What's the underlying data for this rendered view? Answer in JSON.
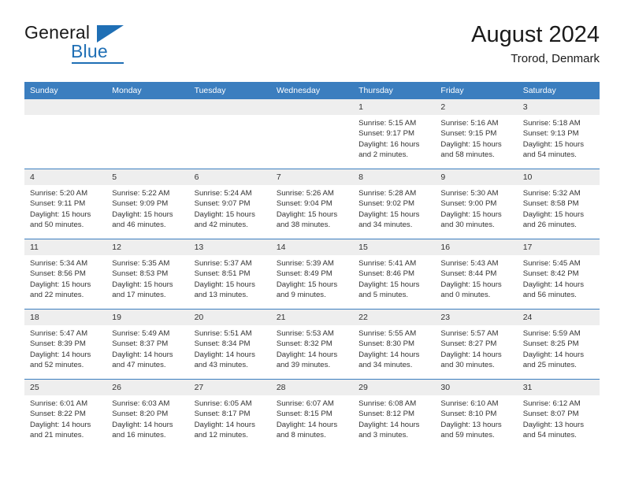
{
  "brand": {
    "name_part1": "General",
    "name_part2": "Blue",
    "flag_icon": "triangle-flag-icon"
  },
  "header": {
    "title": "August 2024",
    "subtitle": "Trorod, Denmark"
  },
  "colors": {
    "header_blue": "#3b7ebf",
    "brand_blue": "#1f6fb5",
    "daynum_band": "#eeeeee",
    "text": "#333333"
  },
  "weekdays": [
    "Sunday",
    "Monday",
    "Tuesday",
    "Wednesday",
    "Thursday",
    "Friday",
    "Saturday"
  ],
  "weeks": [
    [
      {
        "day": "",
        "empty": true,
        "sunrise": "",
        "sunset": "",
        "daylight_line1": "",
        "daylight_line2": ""
      },
      {
        "day": "",
        "empty": true,
        "sunrise": "",
        "sunset": "",
        "daylight_line1": "",
        "daylight_line2": ""
      },
      {
        "day": "",
        "empty": true,
        "sunrise": "",
        "sunset": "",
        "daylight_line1": "",
        "daylight_line2": ""
      },
      {
        "day": "",
        "empty": true,
        "sunrise": "",
        "sunset": "",
        "daylight_line1": "",
        "daylight_line2": ""
      },
      {
        "day": "1",
        "sunrise": "Sunrise: 5:15 AM",
        "sunset": "Sunset: 9:17 PM",
        "daylight_line1": "Daylight: 16 hours",
        "daylight_line2": "and 2 minutes."
      },
      {
        "day": "2",
        "sunrise": "Sunrise: 5:16 AM",
        "sunset": "Sunset: 9:15 PM",
        "daylight_line1": "Daylight: 15 hours",
        "daylight_line2": "and 58 minutes."
      },
      {
        "day": "3",
        "sunrise": "Sunrise: 5:18 AM",
        "sunset": "Sunset: 9:13 PM",
        "daylight_line1": "Daylight: 15 hours",
        "daylight_line2": "and 54 minutes."
      }
    ],
    [
      {
        "day": "4",
        "sunrise": "Sunrise: 5:20 AM",
        "sunset": "Sunset: 9:11 PM",
        "daylight_line1": "Daylight: 15 hours",
        "daylight_line2": "and 50 minutes."
      },
      {
        "day": "5",
        "sunrise": "Sunrise: 5:22 AM",
        "sunset": "Sunset: 9:09 PM",
        "daylight_line1": "Daylight: 15 hours",
        "daylight_line2": "and 46 minutes."
      },
      {
        "day": "6",
        "sunrise": "Sunrise: 5:24 AM",
        "sunset": "Sunset: 9:07 PM",
        "daylight_line1": "Daylight: 15 hours",
        "daylight_line2": "and 42 minutes."
      },
      {
        "day": "7",
        "sunrise": "Sunrise: 5:26 AM",
        "sunset": "Sunset: 9:04 PM",
        "daylight_line1": "Daylight: 15 hours",
        "daylight_line2": "and 38 minutes."
      },
      {
        "day": "8",
        "sunrise": "Sunrise: 5:28 AM",
        "sunset": "Sunset: 9:02 PM",
        "daylight_line1": "Daylight: 15 hours",
        "daylight_line2": "and 34 minutes."
      },
      {
        "day": "9",
        "sunrise": "Sunrise: 5:30 AM",
        "sunset": "Sunset: 9:00 PM",
        "daylight_line1": "Daylight: 15 hours",
        "daylight_line2": "and 30 minutes."
      },
      {
        "day": "10",
        "sunrise": "Sunrise: 5:32 AM",
        "sunset": "Sunset: 8:58 PM",
        "daylight_line1": "Daylight: 15 hours",
        "daylight_line2": "and 26 minutes."
      }
    ],
    [
      {
        "day": "11",
        "sunrise": "Sunrise: 5:34 AM",
        "sunset": "Sunset: 8:56 PM",
        "daylight_line1": "Daylight: 15 hours",
        "daylight_line2": "and 22 minutes."
      },
      {
        "day": "12",
        "sunrise": "Sunrise: 5:35 AM",
        "sunset": "Sunset: 8:53 PM",
        "daylight_line1": "Daylight: 15 hours",
        "daylight_line2": "and 17 minutes."
      },
      {
        "day": "13",
        "sunrise": "Sunrise: 5:37 AM",
        "sunset": "Sunset: 8:51 PM",
        "daylight_line1": "Daylight: 15 hours",
        "daylight_line2": "and 13 minutes."
      },
      {
        "day": "14",
        "sunrise": "Sunrise: 5:39 AM",
        "sunset": "Sunset: 8:49 PM",
        "daylight_line1": "Daylight: 15 hours",
        "daylight_line2": "and 9 minutes."
      },
      {
        "day": "15",
        "sunrise": "Sunrise: 5:41 AM",
        "sunset": "Sunset: 8:46 PM",
        "daylight_line1": "Daylight: 15 hours",
        "daylight_line2": "and 5 minutes."
      },
      {
        "day": "16",
        "sunrise": "Sunrise: 5:43 AM",
        "sunset": "Sunset: 8:44 PM",
        "daylight_line1": "Daylight: 15 hours",
        "daylight_line2": "and 0 minutes."
      },
      {
        "day": "17",
        "sunrise": "Sunrise: 5:45 AM",
        "sunset": "Sunset: 8:42 PM",
        "daylight_line1": "Daylight: 14 hours",
        "daylight_line2": "and 56 minutes."
      }
    ],
    [
      {
        "day": "18",
        "sunrise": "Sunrise: 5:47 AM",
        "sunset": "Sunset: 8:39 PM",
        "daylight_line1": "Daylight: 14 hours",
        "daylight_line2": "and 52 minutes."
      },
      {
        "day": "19",
        "sunrise": "Sunrise: 5:49 AM",
        "sunset": "Sunset: 8:37 PM",
        "daylight_line1": "Daylight: 14 hours",
        "daylight_line2": "and 47 minutes."
      },
      {
        "day": "20",
        "sunrise": "Sunrise: 5:51 AM",
        "sunset": "Sunset: 8:34 PM",
        "daylight_line1": "Daylight: 14 hours",
        "daylight_line2": "and 43 minutes."
      },
      {
        "day": "21",
        "sunrise": "Sunrise: 5:53 AM",
        "sunset": "Sunset: 8:32 PM",
        "daylight_line1": "Daylight: 14 hours",
        "daylight_line2": "and 39 minutes."
      },
      {
        "day": "22",
        "sunrise": "Sunrise: 5:55 AM",
        "sunset": "Sunset: 8:30 PM",
        "daylight_line1": "Daylight: 14 hours",
        "daylight_line2": "and 34 minutes."
      },
      {
        "day": "23",
        "sunrise": "Sunrise: 5:57 AM",
        "sunset": "Sunset: 8:27 PM",
        "daylight_line1": "Daylight: 14 hours",
        "daylight_line2": "and 30 minutes."
      },
      {
        "day": "24",
        "sunrise": "Sunrise: 5:59 AM",
        "sunset": "Sunset: 8:25 PM",
        "daylight_line1": "Daylight: 14 hours",
        "daylight_line2": "and 25 minutes."
      }
    ],
    [
      {
        "day": "25",
        "sunrise": "Sunrise: 6:01 AM",
        "sunset": "Sunset: 8:22 PM",
        "daylight_line1": "Daylight: 14 hours",
        "daylight_line2": "and 21 minutes."
      },
      {
        "day": "26",
        "sunrise": "Sunrise: 6:03 AM",
        "sunset": "Sunset: 8:20 PM",
        "daylight_line1": "Daylight: 14 hours",
        "daylight_line2": "and 16 minutes."
      },
      {
        "day": "27",
        "sunrise": "Sunrise: 6:05 AM",
        "sunset": "Sunset: 8:17 PM",
        "daylight_line1": "Daylight: 14 hours",
        "daylight_line2": "and 12 minutes."
      },
      {
        "day": "28",
        "sunrise": "Sunrise: 6:07 AM",
        "sunset": "Sunset: 8:15 PM",
        "daylight_line1": "Daylight: 14 hours",
        "daylight_line2": "and 8 minutes."
      },
      {
        "day": "29",
        "sunrise": "Sunrise: 6:08 AM",
        "sunset": "Sunset: 8:12 PM",
        "daylight_line1": "Daylight: 14 hours",
        "daylight_line2": "and 3 minutes."
      },
      {
        "day": "30",
        "sunrise": "Sunrise: 6:10 AM",
        "sunset": "Sunset: 8:10 PM",
        "daylight_line1": "Daylight: 13 hours",
        "daylight_line2": "and 59 minutes."
      },
      {
        "day": "31",
        "sunrise": "Sunrise: 6:12 AM",
        "sunset": "Sunset: 8:07 PM",
        "daylight_line1": "Daylight: 13 hours",
        "daylight_line2": "and 54 minutes."
      }
    ]
  ]
}
